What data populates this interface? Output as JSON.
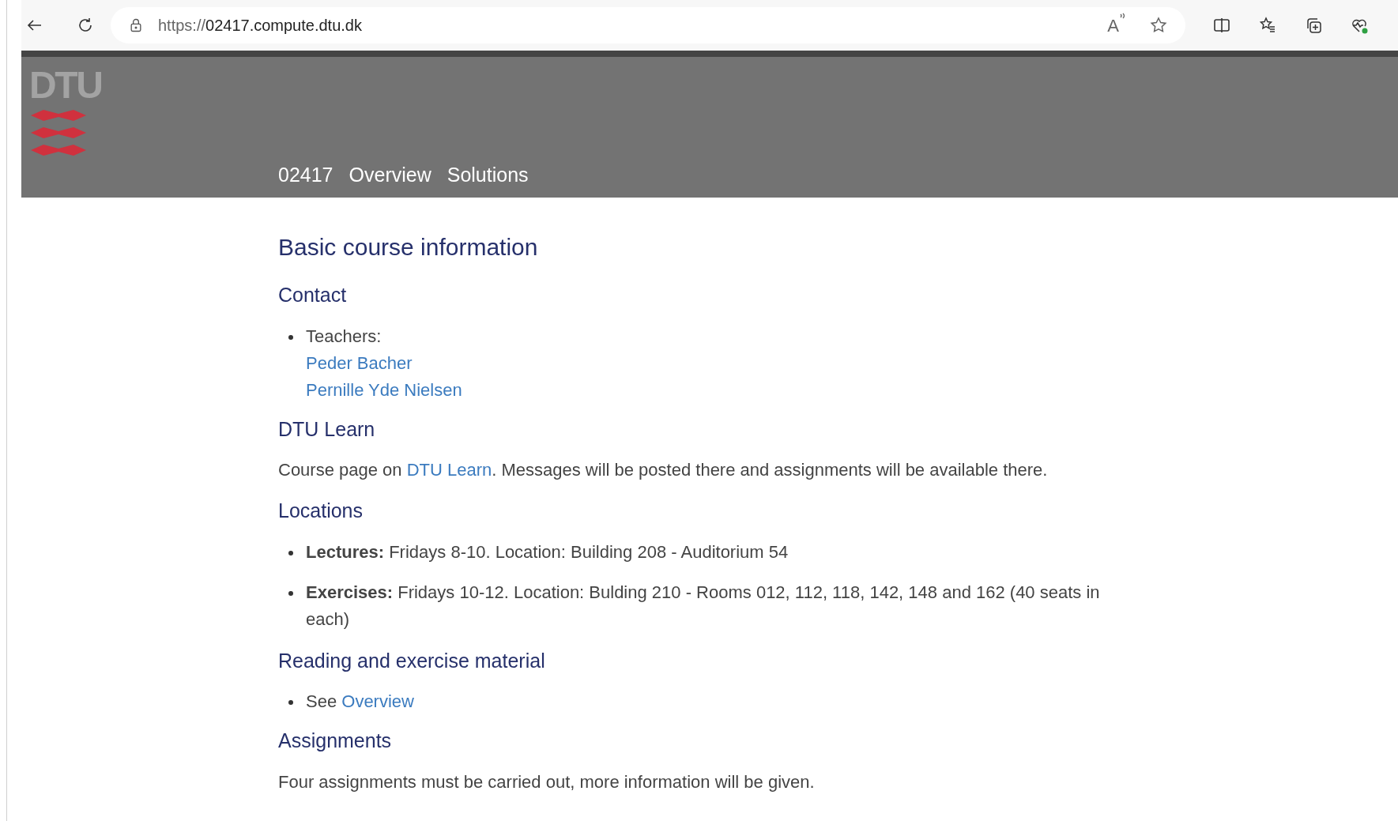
{
  "browser": {
    "url_prefix": "https://",
    "url_host": "02417.compute.dtu.dk",
    "read_aloud": "A"
  },
  "header": {
    "logo_text": "DTU",
    "nav": [
      {
        "label": "02417",
        "kind": "home"
      },
      {
        "label": "Overview",
        "kind": "link"
      },
      {
        "label": "Solutions",
        "kind": "link"
      }
    ]
  },
  "content": [
    {
      "kind": "title",
      "text": "Basic course information"
    },
    {
      "kind": "heading",
      "text": "Contact"
    },
    {
      "kind": "list",
      "items": [
        {
          "kind": "stacked",
          "parts": [
            {
              "kind": "text",
              "text": "Teachers:"
            },
            {
              "kind": "link",
              "text": "Peder Bacher"
            },
            {
              "kind": "link",
              "text": "Pernille Yde Nielsen"
            }
          ]
        }
      ]
    },
    {
      "kind": "heading",
      "text": "DTU Learn"
    },
    {
      "kind": "paragraph",
      "parts": [
        {
          "kind": "text",
          "text": "Course page on "
        },
        {
          "kind": "link",
          "text": "DTU Learn"
        },
        {
          "kind": "text",
          "text": ". Messages will be posted there and assignments will be available there."
        }
      ]
    },
    {
      "kind": "heading",
      "text": "Locations"
    },
    {
      "kind": "list",
      "spaced": true,
      "items": [
        {
          "kind": "inline",
          "parts": [
            {
              "kind": "text",
              "text": "**Lectures:** Fridays 8-10. Location: Building 208 - Auditorium 54"
            }
          ]
        },
        {
          "kind": "inline",
          "parts": [
            {
              "kind": "text",
              "text": "**Exercises:** Fridays 10-12. Location: Bulding 210 - Rooms 012, 112, 118, 142, 148 and 162 (40 seats in each)"
            }
          ]
        }
      ]
    },
    {
      "kind": "heading",
      "text": "Reading and exercise material"
    },
    {
      "kind": "list",
      "items": [
        {
          "kind": "inline",
          "parts": [
            {
              "kind": "text",
              "text": "See "
            },
            {
              "kind": "link",
              "text": "Overview"
            }
          ]
        }
      ]
    },
    {
      "kind": "heading",
      "text": "Assignments"
    },
    {
      "kind": "paragraph",
      "parts": [
        {
          "kind": "text",
          "text": "Four assignments must be carried out, more information will be given."
        }
      ]
    }
  ]
}
